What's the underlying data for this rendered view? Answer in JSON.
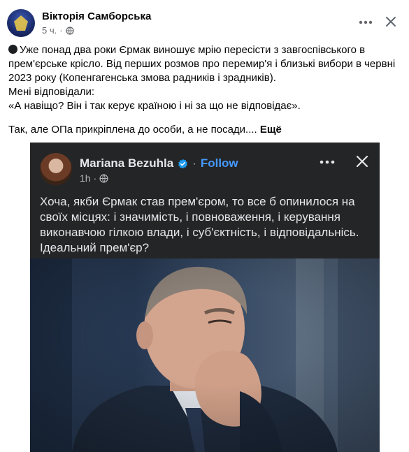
{
  "post": {
    "author": "Вікторія Самборська",
    "time": "5 ч.",
    "meta_dot": "·",
    "text_lines": [
      "Уже понад два роки Єрмак виношує мрію пересісти з завгоспівського в прем'єрське крісло. Від перших розмов про перемир'я і близькі вибори в червні 2023 року (Копенгагенська змова радників і зрадників).",
      "Мені відповідали:",
      "«А навіщо? Він і так керує країною і ні за що не відповідає».",
      "Так, але ОПа прикріплена до особи, а не посади....",
      "Ещё"
    ]
  },
  "embedded": {
    "author": "Mariana Bezuhla",
    "follow": "Follow",
    "dot": "·",
    "time": "1h",
    "meta_dot": "·",
    "text": "Хоча, якби Єрмак став прем'єром, то все б опинилося на своїх місцях: і значимість, і повноваження, і керування виконавчою гілкою влади, і суб'єктність, і відповідальнісь. Ідеальний прем'єр?"
  },
  "icons": {
    "post_dot": "black-circle-icon",
    "privacy": "globe-icon",
    "more": "more-horizontal-icon",
    "close": "close-icon",
    "verified": "verified-badge-icon"
  },
  "colors": {
    "link_blue": "#4599ff",
    "verified_blue": "#1d9bf0",
    "dark_bg": "#242526"
  }
}
